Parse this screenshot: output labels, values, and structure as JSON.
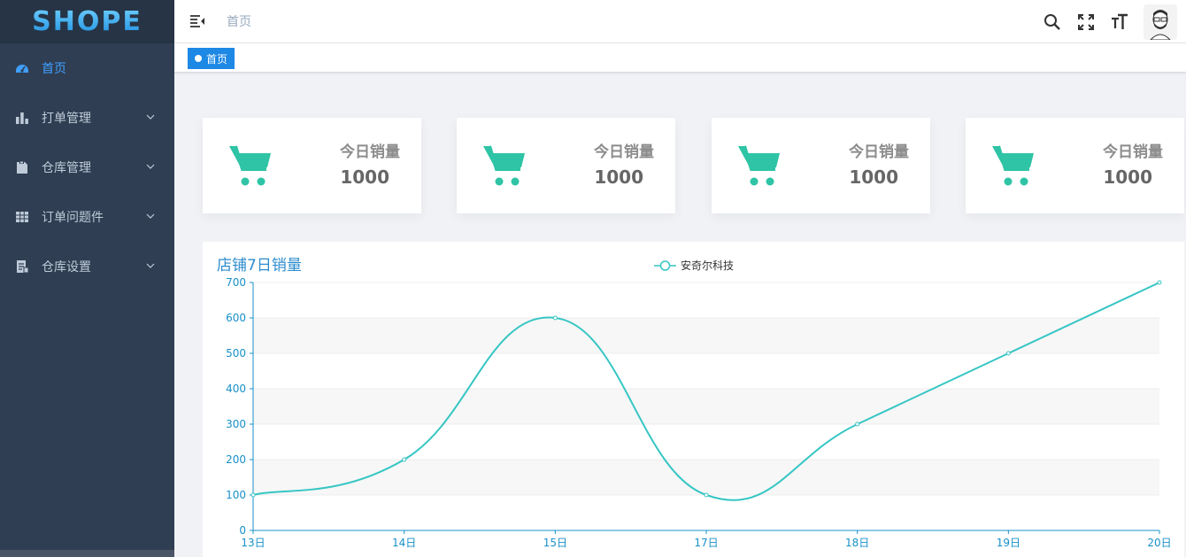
{
  "app": {
    "logo": "SHOPE"
  },
  "sidebar": {
    "items": [
      {
        "label": "首页",
        "icon": "dashboard-icon",
        "active": true
      },
      {
        "label": "打单管理",
        "icon": "bar-chart-icon",
        "active": false
      },
      {
        "label": "仓库管理",
        "icon": "clipboard-icon",
        "active": false
      },
      {
        "label": "订单问题件",
        "icon": "table-icon",
        "active": false
      },
      {
        "label": "仓库设置",
        "icon": "document-icon",
        "active": false
      }
    ]
  },
  "navbar": {
    "breadcrumb": "首页"
  },
  "tags": [
    {
      "label": "首页"
    }
  ],
  "cards": [
    {
      "label": "今日销量",
      "value": "1000"
    },
    {
      "label": "今日销量",
      "value": "1000"
    },
    {
      "label": "今日销量",
      "value": "1000"
    },
    {
      "label": "今日销量",
      "value": "1000"
    }
  ],
  "colors": {
    "accent": "#409eff",
    "teal": "#2ec4a5",
    "line": "#36c6c4",
    "axis": "#1890c8",
    "sidebar": "#2f3e52"
  },
  "chart_data": {
    "type": "line",
    "title": "店铺7日销量",
    "categories": [
      "13日",
      "14日",
      "15日",
      "17日",
      "18日",
      "19日",
      "20日"
    ],
    "series": [
      {
        "name": "安奇尔科技",
        "values": [
          100,
          200,
          600,
          100,
          300,
          500,
          700
        ]
      }
    ],
    "ylim": [
      0,
      700
    ],
    "yticks": [
      0,
      100,
      200,
      300,
      400,
      500,
      600,
      700
    ],
    "legend": "top-center",
    "grid": true
  }
}
